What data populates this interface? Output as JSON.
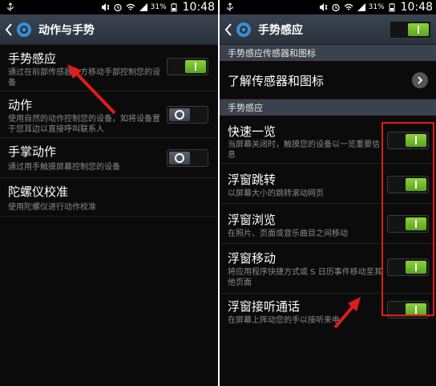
{
  "status_bar": {
    "battery_percent": "31%",
    "time": "10:48"
  },
  "left": {
    "title": "动作与手势",
    "items": [
      {
        "title": "手势感应",
        "desc": "通过在前部传感器上方移动手部控制您的设备",
        "state": "on"
      },
      {
        "title": "动作",
        "desc": "使用自然的动作控制您的设备，如将设备置于您耳边以直接呼叫联系人",
        "state": "off"
      },
      {
        "title": "手掌动作",
        "desc": "通过用手触摸屏幕控制您的设备",
        "state": "off"
      },
      {
        "title": "陀螺仪校准",
        "desc": "使用陀螺仪进行动作校准"
      }
    ]
  },
  "right": {
    "title": "手势感应",
    "section1": "手势感应传感器和图标",
    "learn": "了解传感器和图标",
    "section2": "手势感应",
    "items": [
      {
        "title": "快速一览",
        "desc": "当屏幕关闭时，触摸您的设备以一览重要信息",
        "state": "on"
      },
      {
        "title": "浮窗跳转",
        "desc": "以屏幕大小的跳转滚动网页",
        "state": "on"
      },
      {
        "title": "浮窗浏览",
        "desc": "在照片、页面或音乐曲目之间移动",
        "state": "on"
      },
      {
        "title": "浮窗移动",
        "desc": "将应用程序快捷方式或 S 日历事件移动至其他页面",
        "state": "on"
      },
      {
        "title": "浮窗接听通话",
        "desc": "在屏幕上挥动您的手以接听来电",
        "state": "on"
      }
    ]
  },
  "colors": {
    "accent": "#6dbd2a",
    "highlight": "#e21b1b"
  }
}
